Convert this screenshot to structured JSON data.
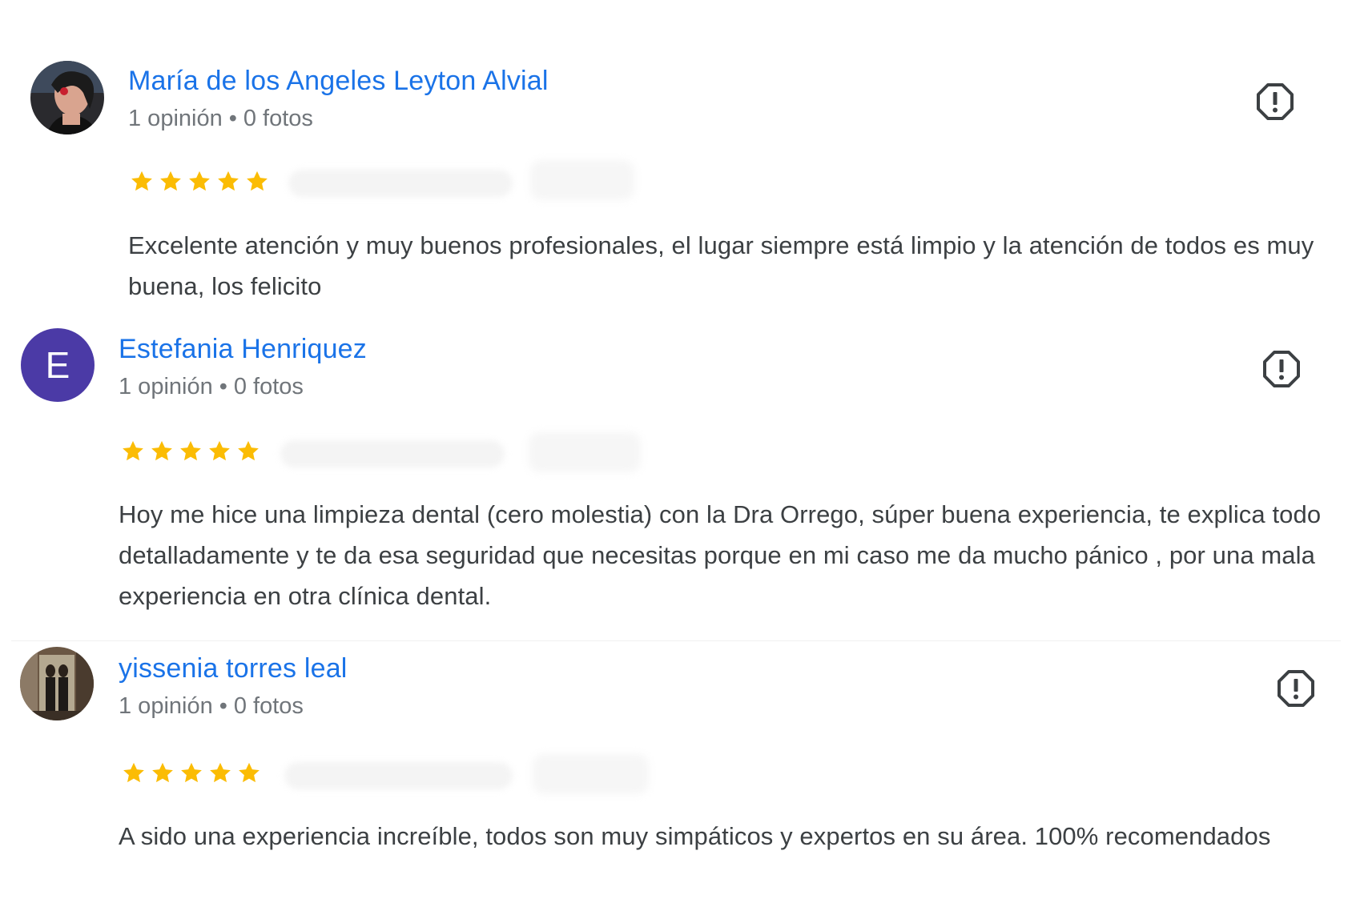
{
  "reviews": [
    {
      "name": "María de los Angeles Leyton Alvial",
      "reviews_count": "1 opinión",
      "separator": "•",
      "photos_count": "0 fotos",
      "rating": 5,
      "avatar_type": "photo",
      "text": "Excelente atención y muy buenos profesionales, el lugar siempre está limpio y la atención de todos es muy buena, los felicito"
    },
    {
      "name": "Estefania Henriquez",
      "reviews_count": "1 opinión",
      "separator": "•",
      "photos_count": "0 fotos",
      "rating": 5,
      "avatar_type": "letter",
      "avatar_letter": "E",
      "text": "Hoy me hice una limpieza dental (cero molestia) con la Dra Orrego, súper buena experiencia, te explica todo detalladamente y te da esa seguridad que necesitas porque en mi caso me da mucho pánico , por una mala experiencia en otra clínica dental."
    },
    {
      "name": "yissenia torres leal",
      "reviews_count": "1 opinión",
      "separator": "•",
      "photos_count": "0 fotos",
      "rating": 5,
      "avatar_type": "photo",
      "text": "A sido una experiencia increíble, todos son muy simpáticos y expertos en su área. 100% recomendados"
    }
  ],
  "colors": {
    "name_link": "#1a73e8",
    "star": "#fbbc04",
    "meta_text": "#70757a",
    "body_text": "#3c4043",
    "letter_avatar_bg": "#4b3aa6"
  },
  "icons": {
    "report": "report-flag-icon",
    "star": "star-icon"
  }
}
